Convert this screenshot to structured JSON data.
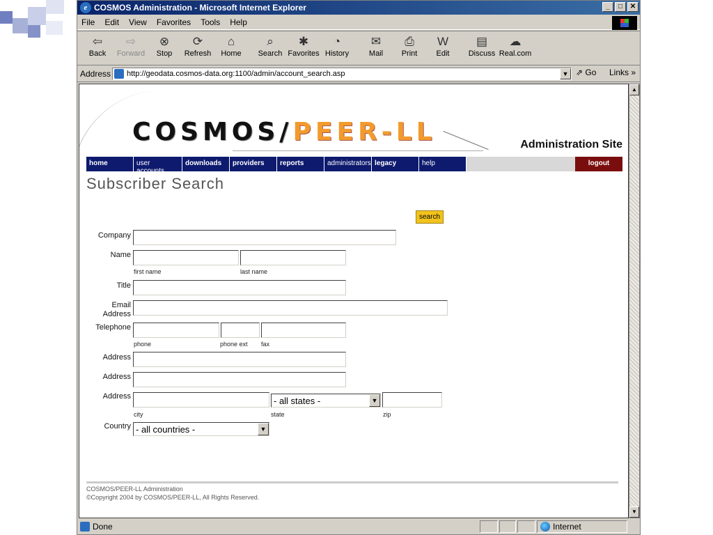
{
  "colors": {
    "title_bar": "#0a246a",
    "nav_bg": "#0d1a6e",
    "logout_bg": "#7a0e0e",
    "search_btn": "#f2c31d",
    "logo_orange": "#f29b2c",
    "slide_square": "#a7b1d8"
  },
  "window": {
    "title": "COSMOS Administration - Microsoft Internet Explorer",
    "icon": "ie-icon"
  },
  "menu": [
    "File",
    "Edit",
    "View",
    "Favorites",
    "Tools",
    "Help"
  ],
  "toolbar": [
    {
      "label": "Back",
      "icon": "back-arrow-icon",
      "glyph": "⇦"
    },
    {
      "label": "Forward",
      "icon": "forward-arrow-icon",
      "glyph": "⇨"
    },
    {
      "label": "Stop",
      "icon": "stop-icon",
      "glyph": "⊗"
    },
    {
      "label": "Refresh",
      "icon": "refresh-icon",
      "glyph": "⟳"
    },
    {
      "label": "Home",
      "icon": "home-icon",
      "glyph": "⌂"
    },
    {
      "label": "Search",
      "icon": "search-icon",
      "glyph": "⌕"
    },
    {
      "label": "Favorites",
      "icon": "favorites-icon",
      "glyph": "✱"
    },
    {
      "label": "History",
      "icon": "history-icon",
      "glyph": "◔"
    },
    {
      "label": "Mail",
      "icon": "mail-icon",
      "glyph": "✉"
    },
    {
      "label": "Print",
      "icon": "print-icon",
      "glyph": "⎙"
    },
    {
      "label": "Edit",
      "icon": "edit-icon",
      "glyph": "W"
    },
    {
      "label": "Discuss",
      "icon": "discuss-icon",
      "glyph": "▤"
    },
    {
      "label": "Real.com",
      "icon": "realcom-icon",
      "glyph": "☁"
    }
  ],
  "address": {
    "label": "Address",
    "url": "http://geodata.cosmos-data.org:1100/admin/account_search.asp",
    "go": "Go",
    "links": "Links"
  },
  "logo": {
    "part1": "COSMOS/",
    "part2": "PEER-LL"
  },
  "header_right": "Administration Site",
  "nav": [
    "home",
    "user accounts",
    "downloads",
    "providers",
    "reports",
    "administrators",
    "legacy",
    "help"
  ],
  "logout": "logout",
  "page_title": "Subscriber Search",
  "search_button": "search",
  "form": {
    "company": "Company",
    "name": "Name",
    "first_name": "first name",
    "last_name": "last name",
    "title": "Title",
    "email": "Email",
    "address_word": "Address",
    "telephone": "Telephone",
    "phone": "phone",
    "phone_ext": "phone ext",
    "fax": "fax",
    "address": "Address",
    "city": "city",
    "state": "state",
    "zip": "zip",
    "state_selected": "- all states -",
    "country": "Country",
    "country_selected": "- all countries -"
  },
  "footer": {
    "line1": "COSMOS/PEER-LL Administration",
    "line2": "©Copyright 2004 by  COSMOS/PEER-LL, All Rights Reserved."
  },
  "status": {
    "text": "Done",
    "zone": "Internet"
  }
}
